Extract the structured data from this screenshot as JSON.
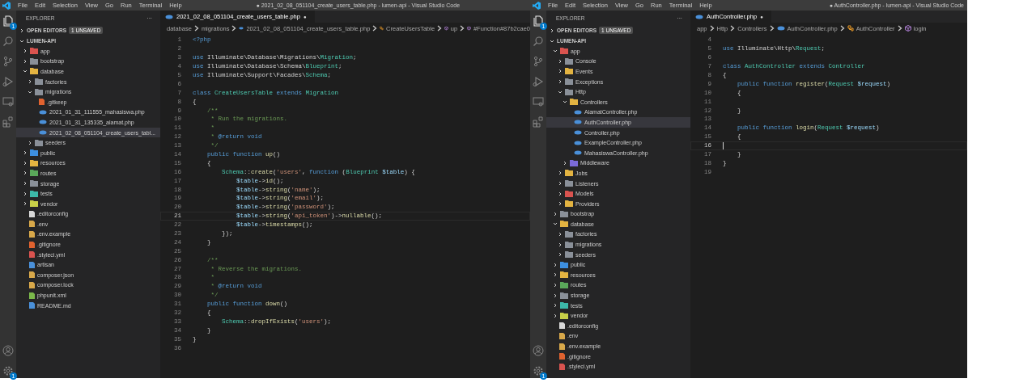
{
  "windows": [
    {
      "menu": [
        "File",
        "Edit",
        "Selection",
        "View",
        "Go",
        "Run",
        "Terminal",
        "Help"
      ],
      "title": "● 2021_02_08_051104_create_users_table.php - lumen-api - Visual Studio Code",
      "activity_bar": {
        "explorer_badge": "1",
        "settings_badge": "1"
      },
      "explorer": {
        "header": "EXPLORER",
        "more": "···",
        "open_editors": "OPEN EDITORS",
        "unsaved_badge": "1 UNSAVED",
        "root": "LUMEN-API",
        "tree": [
          {
            "name": "app",
            "kind": "folder",
            "color": "#d9534f",
            "expanded": false,
            "selected": false
          },
          {
            "name": "bootstrap",
            "kind": "folder",
            "color": "#8a9099",
            "expanded": false,
            "selected": false
          },
          {
            "name": "database",
            "kind": "folder",
            "color": "#e3b341",
            "expanded": true,
            "selected": false,
            "children": [
              {
                "name": "factories",
                "kind": "folder",
                "color": "#8a9099",
                "expanded": false,
                "selected": false
              },
              {
                "name": "migrations",
                "kind": "folder",
                "color": "#8a9099",
                "expanded": true,
                "selected": false,
                "children": [
                  {
                    "name": ".gitkeep",
                    "kind": "file",
                    "color": "#e0622f",
                    "selected": false
                  },
                  {
                    "name": "2021_01_31_111555_mahasiswa.php",
                    "kind": "php",
                    "color": "#4a90d9",
                    "selected": false
                  },
                  {
                    "name": "2021_01_31_135335_alamat.php",
                    "kind": "php",
                    "color": "#4a90d9",
                    "selected": false
                  },
                  {
                    "name": "2021_02_08_051104_create_users_tabl...",
                    "kind": "php",
                    "color": "#4a90d9",
                    "selected": true
                  }
                ]
              },
              {
                "name": "seeders",
                "kind": "folder",
                "color": "#8a9099",
                "expanded": false,
                "selected": false
              }
            ]
          },
          {
            "name": "public",
            "kind": "folder",
            "color": "#3d8fe0",
            "expanded": false,
            "selected": false
          },
          {
            "name": "resources",
            "kind": "folder",
            "color": "#e3b341",
            "expanded": false,
            "selected": false
          },
          {
            "name": "routes",
            "kind": "folder",
            "color": "#5aa85a",
            "expanded": false,
            "selected": false
          },
          {
            "name": "storage",
            "kind": "folder",
            "color": "#8a9099",
            "expanded": false,
            "selected": false
          },
          {
            "name": "tests",
            "kind": "folder",
            "color": "#3cb8a8",
            "expanded": false,
            "selected": false
          },
          {
            "name": "vendor",
            "kind": "folder",
            "color": "#c8d048",
            "expanded": false,
            "selected": false
          },
          {
            "name": ".editorconfig",
            "kind": "file",
            "color": "#d8d8d8",
            "selected": false
          },
          {
            "name": ".env",
            "kind": "file",
            "color": "#d8a84a",
            "selected": false
          },
          {
            "name": ".env.example",
            "kind": "file",
            "color": "#d8a84a",
            "selected": false
          },
          {
            "name": ".gitignore",
            "kind": "file",
            "color": "#e0622f",
            "selected": false
          },
          {
            "name": ".styleci.yml",
            "kind": "file",
            "color": "#d9534f",
            "selected": false
          },
          {
            "name": "artisan",
            "kind": "file",
            "color": "#4a90d9",
            "selected": false
          },
          {
            "name": "composer.json",
            "kind": "file",
            "color": "#d8a84a",
            "selected": false
          },
          {
            "name": "composer.lock",
            "kind": "file",
            "color": "#d8a84a",
            "selected": false
          },
          {
            "name": "phpunit.xml",
            "kind": "file",
            "color": "#7ab84a",
            "selected": false
          },
          {
            "name": "README.md",
            "kind": "file",
            "color": "#4a90d9",
            "selected": false
          }
        ]
      },
      "tab": {
        "name": "2021_02_08_051104_create_users_table.php",
        "dirty": "●"
      },
      "breadcrumbs": [
        {
          "text": "database",
          "kind": "plain"
        },
        {
          "text": "migrations",
          "kind": "plain"
        },
        {
          "text": "2021_02_08_051104_create_users_table.php",
          "kind": "php"
        },
        {
          "text": "CreateUsersTable",
          "kind": "class"
        },
        {
          "text": "up",
          "kind": "method"
        },
        {
          "text": "#Function#87b2cae0",
          "kind": "method"
        }
      ],
      "code": [
        {
          "number": "1",
          "current": false,
          "tokens": [
            {
              "text": "<?php",
              "kind": "kw"
            }
          ]
        },
        {
          "number": "2",
          "current": false
        },
        {
          "number": "3",
          "current": false,
          "tokens": [
            {
              "text": "use",
              "kind": "kw"
            },
            {
              "text": " Illuminate\\Database\\Migrations\\",
              "kind": "plain"
            },
            {
              "text": "Migration",
              "kind": "type"
            },
            {
              "text": ";",
              "kind": "plain"
            }
          ]
        },
        {
          "number": "4",
          "current": false,
          "tokens": [
            {
              "text": "use",
              "kind": "kw"
            },
            {
              "text": " Illuminate\\Database\\Schema\\",
              "kind": "plain"
            },
            {
              "text": "Blueprint",
              "kind": "type"
            },
            {
              "text": ";",
              "kind": "plain"
            }
          ]
        },
        {
          "number": "5",
          "current": false,
          "tokens": [
            {
              "text": "use",
              "kind": "kw"
            },
            {
              "text": " Illuminate\\Support\\Facades\\",
              "kind": "plain"
            },
            {
              "text": "Schema",
              "kind": "type"
            },
            {
              "text": ";",
              "kind": "plain"
            }
          ]
        },
        {
          "number": "6",
          "current": false
        },
        {
          "number": "7",
          "current": false,
          "tokens": [
            {
              "text": "class",
              "kind": "kw"
            },
            {
              "text": " CreateUsersTable",
              "kind": "type"
            },
            {
              "text": " extends",
              "kind": "kw"
            },
            {
              "text": " Migration",
              "kind": "type"
            }
          ]
        },
        {
          "number": "8",
          "current": false,
          "tokens": [
            {
              "text": "{",
              "kind": "plain"
            }
          ]
        },
        {
          "number": "9",
          "current": false,
          "tokens": [
            {
              "text": "    /**",
              "kind": "cmt"
            }
          ]
        },
        {
          "number": "10",
          "current": false,
          "tokens": [
            {
              "text": "     * Run the migrations.",
              "kind": "cmt"
            }
          ]
        },
        {
          "number": "11",
          "current": false,
          "tokens": [
            {
              "text": "     *",
              "kind": "cmt"
            }
          ]
        },
        {
          "number": "12",
          "current": false,
          "tokens": [
            {
              "text": "     * ",
              "kind": "cmt"
            },
            {
              "text": "@return void",
              "kind": "kw"
            }
          ]
        },
        {
          "number": "13",
          "current": false,
          "tokens": [
            {
              "text": "     */",
              "kind": "cmt"
            }
          ]
        },
        {
          "number": "14",
          "current": false,
          "tokens": [
            {
              "text": "    public function",
              "kind": "kw"
            },
            {
              "text": " up",
              "kind": "fn"
            },
            {
              "text": "()",
              "kind": "plain"
            }
          ]
        },
        {
          "number": "15",
          "current": false,
          "tokens": [
            {
              "text": "    {",
              "kind": "plain"
            }
          ]
        },
        {
          "number": "16",
          "current": false,
          "tokens": [
            {
              "text": "        Schema",
              "kind": "type"
            },
            {
              "text": "::",
              "kind": "plain"
            },
            {
              "text": "create",
              "kind": "fn"
            },
            {
              "text": "(",
              "kind": "plain"
            },
            {
              "text": "'users'",
              "kind": "str"
            },
            {
              "text": ", ",
              "kind": "plain"
            },
            {
              "text": "function",
              "kind": "kw"
            },
            {
              "text": " (",
              "kind": "plain"
            },
            {
              "text": "Blueprint",
              "kind": "type"
            },
            {
              "text": " $table",
              "kind": "var"
            },
            {
              "text": ") {",
              "kind": "plain"
            }
          ]
        },
        {
          "number": "17",
          "current": false,
          "tokens": [
            {
              "text": "            $table",
              "kind": "var"
            },
            {
              "text": "->",
              "kind": "plain"
            },
            {
              "text": "id",
              "kind": "fn"
            },
            {
              "text": "();",
              "kind": "plain"
            }
          ]
        },
        {
          "number": "18",
          "current": false,
          "tokens": [
            {
              "text": "            $table",
              "kind": "var"
            },
            {
              "text": "->",
              "kind": "plain"
            },
            {
              "text": "string",
              "kind": "fn"
            },
            {
              "text": "(",
              "kind": "plain"
            },
            {
              "text": "'name'",
              "kind": "str"
            },
            {
              "text": ");",
              "kind": "plain"
            }
          ]
        },
        {
          "number": "19",
          "current": false,
          "tokens": [
            {
              "text": "            $table",
              "kind": "var"
            },
            {
              "text": "->",
              "kind": "plain"
            },
            {
              "text": "string",
              "kind": "fn"
            },
            {
              "text": "(",
              "kind": "plain"
            },
            {
              "text": "'email'",
              "kind": "str"
            },
            {
              "text": ");",
              "kind": "plain"
            }
          ]
        },
        {
          "number": "20",
          "current": false,
          "tokens": [
            {
              "text": "            $table",
              "kind": "var"
            },
            {
              "text": "->",
              "kind": "plain"
            },
            {
              "text": "string",
              "kind": "fn"
            },
            {
              "text": "(",
              "kind": "plain"
            },
            {
              "text": "'password'",
              "kind": "str"
            },
            {
              "text": ");",
              "kind": "plain"
            }
          ]
        },
        {
          "number": "21",
          "current": true,
          "tokens": [
            {
              "text": "            $table",
              "kind": "var"
            },
            {
              "text": "->",
              "kind": "plain"
            },
            {
              "text": "string",
              "kind": "fn"
            },
            {
              "text": "(",
              "kind": "plain"
            },
            {
              "text": "'api_token'",
              "kind": "str"
            },
            {
              "text": ")->",
              "kind": "plain"
            },
            {
              "text": "nullable",
              "kind": "fn"
            },
            {
              "text": "();",
              "kind": "plain"
            }
          ]
        },
        {
          "number": "22",
          "current": false,
          "tokens": [
            {
              "text": "            $table",
              "kind": "var"
            },
            {
              "text": "->",
              "kind": "plain"
            },
            {
              "text": "timestamps",
              "kind": "fn"
            },
            {
              "text": "();",
              "kind": "plain"
            }
          ]
        },
        {
          "number": "23",
          "current": false,
          "tokens": [
            {
              "text": "        });",
              "kind": "plain"
            }
          ]
        },
        {
          "number": "24",
          "current": false,
          "tokens": [
            {
              "text": "    }",
              "kind": "plain"
            }
          ]
        },
        {
          "number": "25",
          "current": false
        },
        {
          "number": "26",
          "current": false,
          "tokens": [
            {
              "text": "    /**",
              "kind": "cmt"
            }
          ]
        },
        {
          "number": "27",
          "current": false,
          "tokens": [
            {
              "text": "     * Reverse the migrations.",
              "kind": "cmt"
            }
          ]
        },
        {
          "number": "28",
          "current": false,
          "tokens": [
            {
              "text": "     *",
              "kind": "cmt"
            }
          ]
        },
        {
          "number": "29",
          "current": false,
          "tokens": [
            {
              "text": "     * ",
              "kind": "cmt"
            },
            {
              "text": "@return void",
              "kind": "kw"
            }
          ]
        },
        {
          "number": "30",
          "current": false,
          "tokens": [
            {
              "text": "     */",
              "kind": "cmt"
            }
          ]
        },
        {
          "number": "31",
          "current": false,
          "tokens": [
            {
              "text": "    public function",
              "kind": "kw"
            },
            {
              "text": " down",
              "kind": "fn"
            },
            {
              "text": "()",
              "kind": "plain"
            }
          ]
        },
        {
          "number": "32",
          "current": false,
          "tokens": [
            {
              "text": "    {",
              "kind": "plain"
            }
          ]
        },
        {
          "number": "33",
          "current": false,
          "tokens": [
            {
              "text": "        Schema",
              "kind": "type"
            },
            {
              "text": "::",
              "kind": "plain"
            },
            {
              "text": "dropIfExists",
              "kind": "fn"
            },
            {
              "text": "(",
              "kind": "plain"
            },
            {
              "text": "'users'",
              "kind": "str"
            },
            {
              "text": ");",
              "kind": "plain"
            }
          ]
        },
        {
          "number": "34",
          "current": false,
          "tokens": [
            {
              "text": "    }",
              "kind": "plain"
            }
          ]
        },
        {
          "number": "35",
          "current": false,
          "tokens": [
            {
              "text": "}",
              "kind": "plain"
            }
          ]
        },
        {
          "number": "36",
          "current": false
        }
      ]
    },
    {
      "menu": [
        "File",
        "Edit",
        "Selection",
        "View",
        "Go",
        "Run",
        "Terminal",
        "Help"
      ],
      "title": "● AuthController.php - lumen-api - Visual Studio Code",
      "activity_bar": {
        "explorer_badge": "1",
        "settings_badge": "1"
      },
      "explorer": {
        "header": "EXPLORER",
        "more": "···",
        "open_editors": "OPEN EDITORS",
        "unsaved_badge": "1 UNSAVED",
        "root": "LUMEN-API",
        "tree": [
          {
            "name": "app",
            "kind": "folder",
            "color": "#d9534f",
            "expanded": true,
            "selected": false,
            "children": [
              {
                "name": "Console",
                "kind": "folder",
                "color": "#8a9099",
                "expanded": false,
                "selected": false
              },
              {
                "name": "Events",
                "kind": "folder",
                "color": "#e3b341",
                "expanded": false,
                "selected": false
              },
              {
                "name": "Exceptions",
                "kind": "folder",
                "color": "#8a9099",
                "expanded": false,
                "selected": false
              },
              {
                "name": "Http",
                "kind": "folder",
                "color": "#8a9099",
                "expanded": true,
                "selected": false,
                "children": [
                  {
                    "name": "Controllers",
                    "kind": "folder",
                    "color": "#e3b341",
                    "expanded": true,
                    "selected": false,
                    "children": [
                      {
                        "name": "AlamatController.php",
                        "kind": "php",
                        "color": "#4a90d9",
                        "selected": false
                      },
                      {
                        "name": "AuthController.php",
                        "kind": "php",
                        "color": "#4a90d9",
                        "selected": true
                      },
                      {
                        "name": "Controller.php",
                        "kind": "php",
                        "color": "#4a90d9",
                        "selected": false
                      },
                      {
                        "name": "ExampleController.php",
                        "kind": "php",
                        "color": "#4a90d9",
                        "selected": false
                      },
                      {
                        "name": "MahasiswaController.php",
                        "kind": "php",
                        "color": "#4a90d9",
                        "selected": false
                      }
                    ]
                  },
                  {
                    "name": "Middleware",
                    "kind": "folder",
                    "color": "#7a6ad8",
                    "expanded": false,
                    "selected": false
                  }
                ]
              },
              {
                "name": "Jobs",
                "kind": "folder",
                "color": "#e3b341",
                "expanded": false,
                "selected": false
              },
              {
                "name": "Listeners",
                "kind": "folder",
                "color": "#8a9099",
                "expanded": false,
                "selected": false
              },
              {
                "name": "Models",
                "kind": "folder",
                "color": "#d9534f",
                "expanded": false,
                "selected": false
              },
              {
                "name": "Providers",
                "kind": "folder",
                "color": "#e3b341",
                "expanded": false,
                "selected": false
              }
            ]
          },
          {
            "name": "bootstrap",
            "kind": "folder",
            "color": "#8a9099",
            "expanded": false,
            "selected": false
          },
          {
            "name": "database",
            "kind": "folder",
            "color": "#e3b341",
            "expanded": true,
            "selected": false,
            "children": [
              {
                "name": "factories",
                "kind": "folder",
                "color": "#8a9099",
                "expanded": false,
                "selected": false
              },
              {
                "name": "migrations",
                "kind": "folder",
                "color": "#8a9099",
                "expanded": false,
                "selected": false
              },
              {
                "name": "seeders",
                "kind": "folder",
                "color": "#8a9099",
                "expanded": false,
                "selected": false
              }
            ]
          },
          {
            "name": "public",
            "kind": "folder",
            "color": "#3d8fe0",
            "expanded": false,
            "selected": false
          },
          {
            "name": "resources",
            "kind": "folder",
            "color": "#e3b341",
            "expanded": false,
            "selected": false
          },
          {
            "name": "routes",
            "kind": "folder",
            "color": "#5aa85a",
            "expanded": false,
            "selected": false
          },
          {
            "name": "storage",
            "kind": "folder",
            "color": "#8a9099",
            "expanded": false,
            "selected": false
          },
          {
            "name": "tests",
            "kind": "folder",
            "color": "#3cb8a8",
            "expanded": false,
            "selected": false
          },
          {
            "name": "vendor",
            "kind": "folder",
            "color": "#c8d048",
            "expanded": false,
            "selected": false
          },
          {
            "name": ".editorconfig",
            "kind": "file",
            "color": "#d8d8d8",
            "selected": false
          },
          {
            "name": ".env",
            "kind": "file",
            "color": "#d8a84a",
            "selected": false
          },
          {
            "name": ".env.example",
            "kind": "file",
            "color": "#d8a84a",
            "selected": false
          },
          {
            "name": ".gitignore",
            "kind": "file",
            "color": "#e0622f",
            "selected": false
          },
          {
            "name": ".styleci.yml",
            "kind": "file",
            "color": "#d9534f",
            "selected": false
          }
        ]
      },
      "tab": {
        "name": "AuthController.php",
        "dirty": "●"
      },
      "breadcrumbs": [
        {
          "text": "app",
          "kind": "plain"
        },
        {
          "text": "Http",
          "kind": "plain"
        },
        {
          "text": "Controllers",
          "kind": "plain"
        },
        {
          "text": "AuthController.php",
          "kind": "php"
        },
        {
          "text": "AuthController",
          "kind": "class"
        },
        {
          "text": "login",
          "kind": "method"
        }
      ],
      "code": [
        {
          "number": "4",
          "current": false
        },
        {
          "number": "5",
          "current": false,
          "tokens": [
            {
              "text": "use",
              "kind": "kw"
            },
            {
              "text": " Illuminate\\Http\\",
              "kind": "plain"
            },
            {
              "text": "Request",
              "kind": "type"
            },
            {
              "text": ";",
              "kind": "plain"
            }
          ]
        },
        {
          "number": "6",
          "current": false
        },
        {
          "number": "7",
          "current": false,
          "tokens": [
            {
              "text": "class",
              "kind": "kw"
            },
            {
              "text": " AuthController",
              "kind": "type"
            },
            {
              "text": " extends",
              "kind": "kw"
            },
            {
              "text": " Controller",
              "kind": "type"
            }
          ]
        },
        {
          "number": "8",
          "current": false,
          "tokens": [
            {
              "text": "{",
              "kind": "plain"
            }
          ]
        },
        {
          "number": "9",
          "current": false,
          "tokens": [
            {
              "text": "    public function",
              "kind": "kw"
            },
            {
              "text": " register",
              "kind": "fn"
            },
            {
              "text": "(",
              "kind": "plain"
            },
            {
              "text": "Request",
              "kind": "type"
            },
            {
              "text": " $request",
              "kind": "var"
            },
            {
              "text": ")",
              "kind": "plain"
            }
          ]
        },
        {
          "number": "10",
          "current": false,
          "tokens": [
            {
              "text": "    {",
              "kind": "plain"
            }
          ]
        },
        {
          "number": "11",
          "current": false
        },
        {
          "number": "12",
          "current": false,
          "tokens": [
            {
              "text": "    }",
              "kind": "plain"
            }
          ]
        },
        {
          "number": "13",
          "current": false
        },
        {
          "number": "14",
          "current": false,
          "tokens": [
            {
              "text": "    public function",
              "kind": "kw"
            },
            {
              "text": " login",
              "kind": "fn"
            },
            {
              "text": "(",
              "kind": "plain"
            },
            {
              "text": "Request",
              "kind": "type"
            },
            {
              "text": " $request",
              "kind": "var"
            },
            {
              "text": ")",
              "kind": "plain"
            }
          ]
        },
        {
          "number": "15",
          "current": false,
          "tokens": [
            {
              "text": "    {",
              "kind": "plain"
            }
          ]
        },
        {
          "number": "16",
          "current": true
        },
        {
          "number": "17",
          "current": false,
          "tokens": [
            {
              "text": "    }",
              "kind": "plain"
            }
          ]
        },
        {
          "number": "18",
          "current": false,
          "tokens": [
            {
              "text": "}",
              "kind": "plain"
            }
          ]
        },
        {
          "number": "19",
          "current": false
        }
      ]
    }
  ]
}
